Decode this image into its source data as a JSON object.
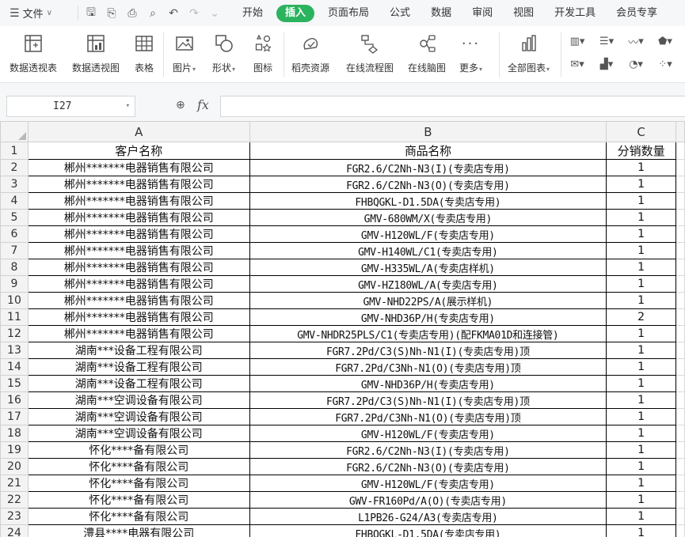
{
  "menu": {
    "file_label": "文件",
    "tabs": [
      "开始",
      "插入",
      "页面布局",
      "公式",
      "数据",
      "审阅",
      "视图",
      "开发工具",
      "会员专享"
    ],
    "active_tab": "插入"
  },
  "ribbon": {
    "pivot_table": "数据透视表",
    "pivot_chart": "数据透视图",
    "table": "表格",
    "picture": "图片",
    "shape": "形状",
    "icon": "图标",
    "resources": "稻壳资源",
    "flowchart": "在线流程图",
    "mindmap": "在线脑图",
    "more": "更多",
    "all_charts": "全部图表"
  },
  "formula_bar": {
    "name_box": "I27",
    "fx": "fx",
    "formula": ""
  },
  "sheet": {
    "columns": [
      "A",
      "B",
      "C"
    ],
    "rows": [
      {
        "n": "1",
        "a": "客户名称",
        "b": "商品名称",
        "c": "分销数量"
      },
      {
        "n": "2",
        "a": "郴州*******电器销售有限公司",
        "b": "FGR2.6/C2Nh-N3(I)(专卖店专用)",
        "c": "1"
      },
      {
        "n": "3",
        "a": "郴州*******电器销售有限公司",
        "b": "FGR2.6/C2Nh-N3(O)(专卖店专用)",
        "c": "1"
      },
      {
        "n": "4",
        "a": "郴州*******电器销售有限公司",
        "b": "FHBQGKL-D1.5DA(专卖店专用)",
        "c": "1"
      },
      {
        "n": "5",
        "a": "郴州*******电器销售有限公司",
        "b": "GMV-680WM/X(专卖店专用)",
        "c": "1"
      },
      {
        "n": "6",
        "a": "郴州*******电器销售有限公司",
        "b": "GMV-H120WL/F(专卖店专用)",
        "c": "1"
      },
      {
        "n": "7",
        "a": "郴州*******电器销售有限公司",
        "b": "GMV-H140WL/C1(专卖店专用)",
        "c": "1"
      },
      {
        "n": "8",
        "a": "郴州*******电器销售有限公司",
        "b": "GMV-H335WL/A(专卖店样机)",
        "c": "1"
      },
      {
        "n": "9",
        "a": "郴州*******电器销售有限公司",
        "b": "GMV-HZ180WL/A(专卖店专用)",
        "c": "1"
      },
      {
        "n": "10",
        "a": "郴州*******电器销售有限公司",
        "b": "GMV-NHD22PS/A(展示样机)",
        "c": "1"
      },
      {
        "n": "11",
        "a": "郴州*******电器销售有限公司",
        "b": "GMV-NHD36P/H(专卖店专用)",
        "c": "2"
      },
      {
        "n": "12",
        "a": "郴州*******电器销售有限公司",
        "b": "GMV-NHDR25PLS/C1(专卖店专用)(配FKMA01D和连接管)",
        "c": "1"
      },
      {
        "n": "13",
        "a": "湖南***设备工程有限公司",
        "b": "FGR7.2Pd/C3(S)Nh-N1(I)(专卖店专用)顶",
        "c": "1"
      },
      {
        "n": "14",
        "a": "湖南***设备工程有限公司",
        "b": "FGR7.2Pd/C3Nh-N1(O)(专卖店专用)顶",
        "c": "1"
      },
      {
        "n": "15",
        "a": "湖南***设备工程有限公司",
        "b": "GMV-NHD36P/H(专卖店专用)",
        "c": "1"
      },
      {
        "n": "16",
        "a": "湖南***空调设备有限公司",
        "b": "FGR7.2Pd/C3(S)Nh-N1(I)(专卖店专用)顶",
        "c": "1"
      },
      {
        "n": "17",
        "a": "湖南***空调设备有限公司",
        "b": "FGR7.2Pd/C3Nh-N1(O)(专卖店专用)顶",
        "c": "1"
      },
      {
        "n": "18",
        "a": "湖南***空调设备有限公司",
        "b": "GMV-H120WL/F(专卖店专用)",
        "c": "1"
      },
      {
        "n": "19",
        "a": "怀化****备有限公司",
        "b": "FGR2.6/C2Nh-N3(I)(专卖店专用)",
        "c": "1"
      },
      {
        "n": "20",
        "a": "怀化****备有限公司",
        "b": "FGR2.6/C2Nh-N3(O)(专卖店专用)",
        "c": "1"
      },
      {
        "n": "21",
        "a": "怀化****备有限公司",
        "b": "GMV-H120WL/F(专卖店专用)",
        "c": "1"
      },
      {
        "n": "22",
        "a": "怀化****备有限公司",
        "b": "GWV-FR160Pd/A(O)(专卖店专用)",
        "c": "1"
      },
      {
        "n": "23",
        "a": "怀化****备有限公司",
        "b": "L1PB26-G24/A3(专卖店专用)",
        "c": "1"
      },
      {
        "n": "24",
        "a": "澧县****电器有限公司",
        "b": "FHBQGKL-D1.5DA(专卖店专用)",
        "c": "1"
      }
    ]
  }
}
